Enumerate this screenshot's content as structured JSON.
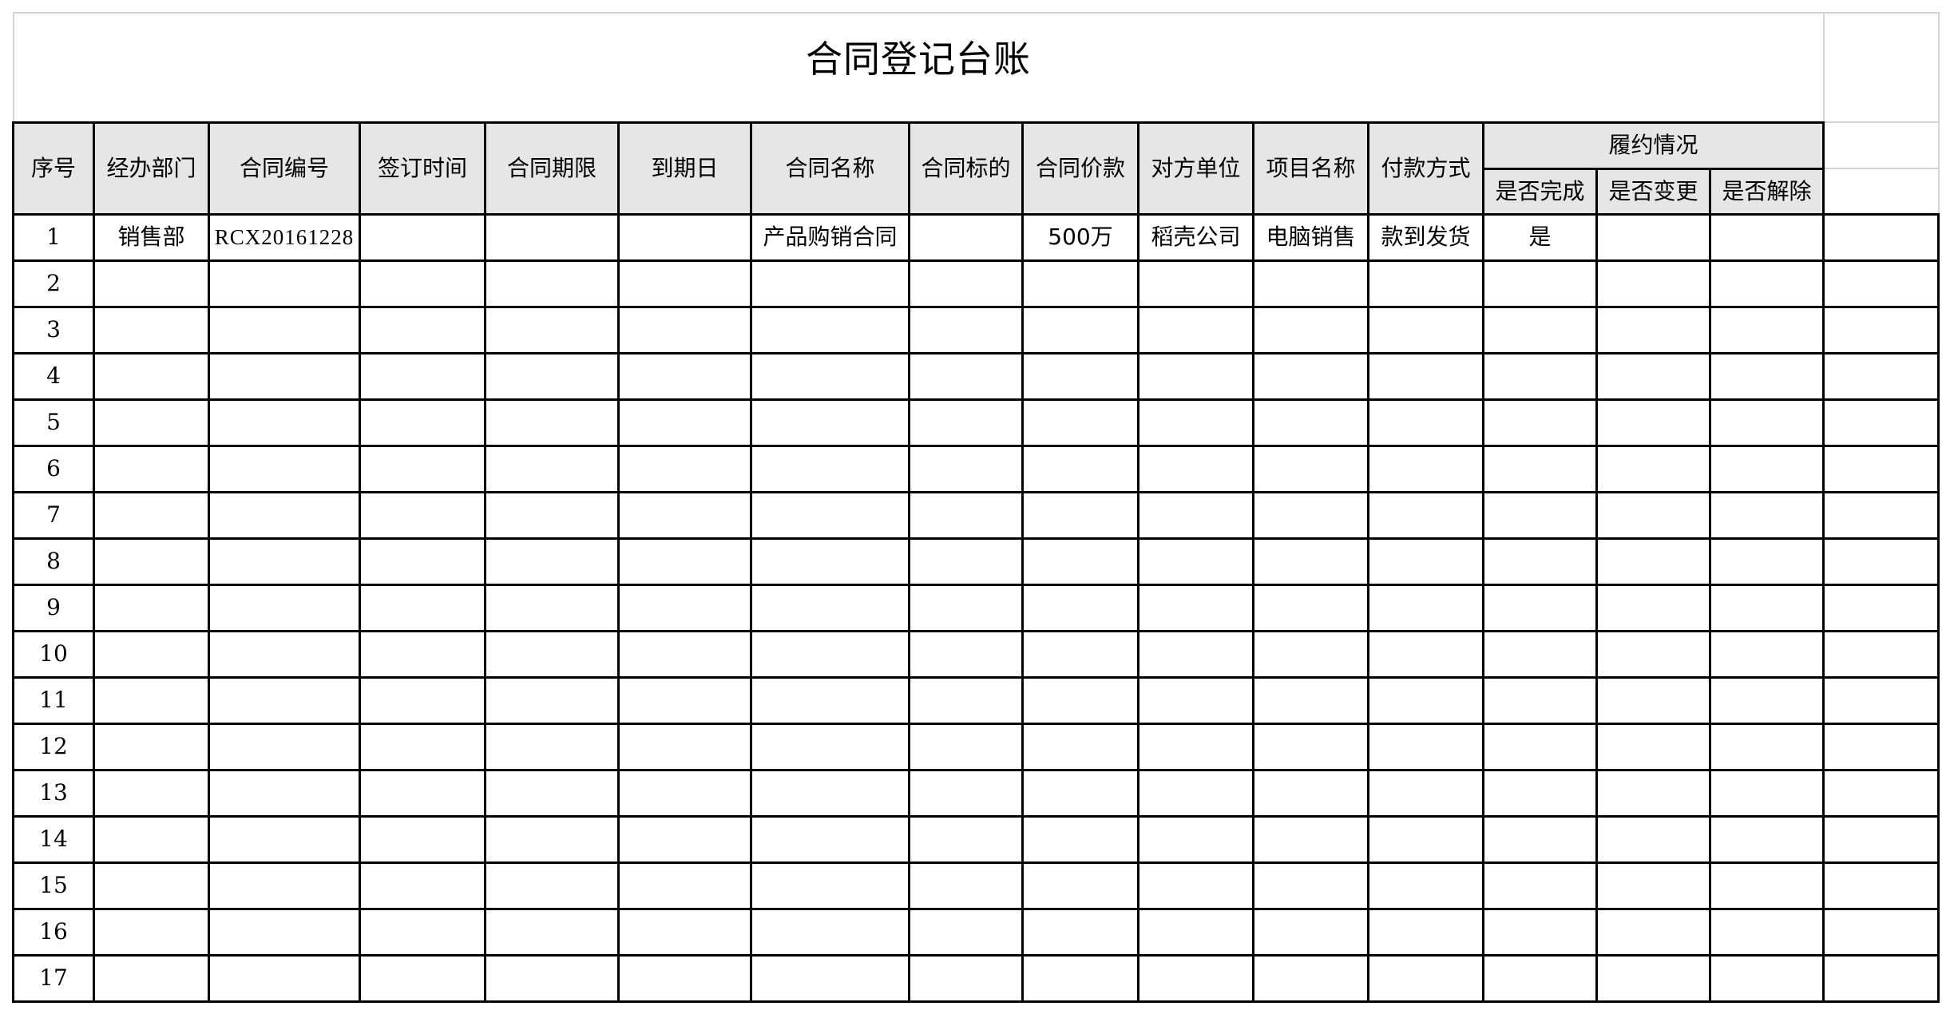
{
  "title": "合同登记台账",
  "header": {
    "columns": [
      "序号",
      "经办部门",
      "合同编号",
      "签订时间",
      "合同期限",
      "到期日",
      "合同名称",
      "合同标的",
      "合同价款",
      "对方单位",
      "项目名称",
      "付款方式"
    ],
    "group_label": "履约情况",
    "group_columns": [
      "是否完成",
      "是否变更",
      "是否解除"
    ]
  },
  "rows": [
    {
      "no": "1",
      "dept": "销售部",
      "contract_no": "RCX20161228",
      "sign_date": "",
      "term": "",
      "due_date": "",
      "name": "产品购销合同",
      "subject": "",
      "price": "500万",
      "counterparty": "稻壳公司",
      "project": "电脑销售",
      "payment": "款到发货",
      "completed": "是",
      "changed": "",
      "terminated": ""
    },
    {
      "no": "2",
      "dept": "",
      "contract_no": "",
      "sign_date": "",
      "term": "",
      "due_date": "",
      "name": "",
      "subject": "",
      "price": "",
      "counterparty": "",
      "project": "",
      "payment": "",
      "completed": "",
      "changed": "",
      "terminated": ""
    },
    {
      "no": "3",
      "dept": "",
      "contract_no": "",
      "sign_date": "",
      "term": "",
      "due_date": "",
      "name": "",
      "subject": "",
      "price": "",
      "counterparty": "",
      "project": "",
      "payment": "",
      "completed": "",
      "changed": "",
      "terminated": ""
    },
    {
      "no": "4",
      "dept": "",
      "contract_no": "",
      "sign_date": "",
      "term": "",
      "due_date": "",
      "name": "",
      "subject": "",
      "price": "",
      "counterparty": "",
      "project": "",
      "payment": "",
      "completed": "",
      "changed": "",
      "terminated": ""
    },
    {
      "no": "5",
      "dept": "",
      "contract_no": "",
      "sign_date": "",
      "term": "",
      "due_date": "",
      "name": "",
      "subject": "",
      "price": "",
      "counterparty": "",
      "project": "",
      "payment": "",
      "completed": "",
      "changed": "",
      "terminated": ""
    },
    {
      "no": "6",
      "dept": "",
      "contract_no": "",
      "sign_date": "",
      "term": "",
      "due_date": "",
      "name": "",
      "subject": "",
      "price": "",
      "counterparty": "",
      "project": "",
      "payment": "",
      "completed": "",
      "changed": "",
      "terminated": ""
    },
    {
      "no": "7",
      "dept": "",
      "contract_no": "",
      "sign_date": "",
      "term": "",
      "due_date": "",
      "name": "",
      "subject": "",
      "price": "",
      "counterparty": "",
      "project": "",
      "payment": "",
      "completed": "",
      "changed": "",
      "terminated": ""
    },
    {
      "no": "8",
      "dept": "",
      "contract_no": "",
      "sign_date": "",
      "term": "",
      "due_date": "",
      "name": "",
      "subject": "",
      "price": "",
      "counterparty": "",
      "project": "",
      "payment": "",
      "completed": "",
      "changed": "",
      "terminated": ""
    },
    {
      "no": "9",
      "dept": "",
      "contract_no": "",
      "sign_date": "",
      "term": "",
      "due_date": "",
      "name": "",
      "subject": "",
      "price": "",
      "counterparty": "",
      "project": "",
      "payment": "",
      "completed": "",
      "changed": "",
      "terminated": ""
    },
    {
      "no": "10",
      "dept": "",
      "contract_no": "",
      "sign_date": "",
      "term": "",
      "due_date": "",
      "name": "",
      "subject": "",
      "price": "",
      "counterparty": "",
      "project": "",
      "payment": "",
      "completed": "",
      "changed": "",
      "terminated": ""
    },
    {
      "no": "11",
      "dept": "",
      "contract_no": "",
      "sign_date": "",
      "term": "",
      "due_date": "",
      "name": "",
      "subject": "",
      "price": "",
      "counterparty": "",
      "project": "",
      "payment": "",
      "completed": "",
      "changed": "",
      "terminated": ""
    },
    {
      "no": "12",
      "dept": "",
      "contract_no": "",
      "sign_date": "",
      "term": "",
      "due_date": "",
      "name": "",
      "subject": "",
      "price": "",
      "counterparty": "",
      "project": "",
      "payment": "",
      "completed": "",
      "changed": "",
      "terminated": ""
    },
    {
      "no": "13",
      "dept": "",
      "contract_no": "",
      "sign_date": "",
      "term": "",
      "due_date": "",
      "name": "",
      "subject": "",
      "price": "",
      "counterparty": "",
      "project": "",
      "payment": "",
      "completed": "",
      "changed": "",
      "terminated": ""
    },
    {
      "no": "14",
      "dept": "",
      "contract_no": "",
      "sign_date": "",
      "term": "",
      "due_date": "",
      "name": "",
      "subject": "",
      "price": "",
      "counterparty": "",
      "project": "",
      "payment": "",
      "completed": "",
      "changed": "",
      "terminated": ""
    },
    {
      "no": "15",
      "dept": "",
      "contract_no": "",
      "sign_date": "",
      "term": "",
      "due_date": "",
      "name": "",
      "subject": "",
      "price": "",
      "counterparty": "",
      "project": "",
      "payment": "",
      "completed": "",
      "changed": "",
      "terminated": ""
    },
    {
      "no": "16",
      "dept": "",
      "contract_no": "",
      "sign_date": "",
      "term": "",
      "due_date": "",
      "name": "",
      "subject": "",
      "price": "",
      "counterparty": "",
      "project": "",
      "payment": "",
      "completed": "",
      "changed": "",
      "terminated": ""
    },
    {
      "no": "17",
      "dept": "",
      "contract_no": "",
      "sign_date": "",
      "term": "",
      "due_date": "",
      "name": "",
      "subject": "",
      "price": "",
      "counterparty": "",
      "project": "",
      "payment": "",
      "completed": "",
      "changed": "",
      "terminated": ""
    }
  ]
}
